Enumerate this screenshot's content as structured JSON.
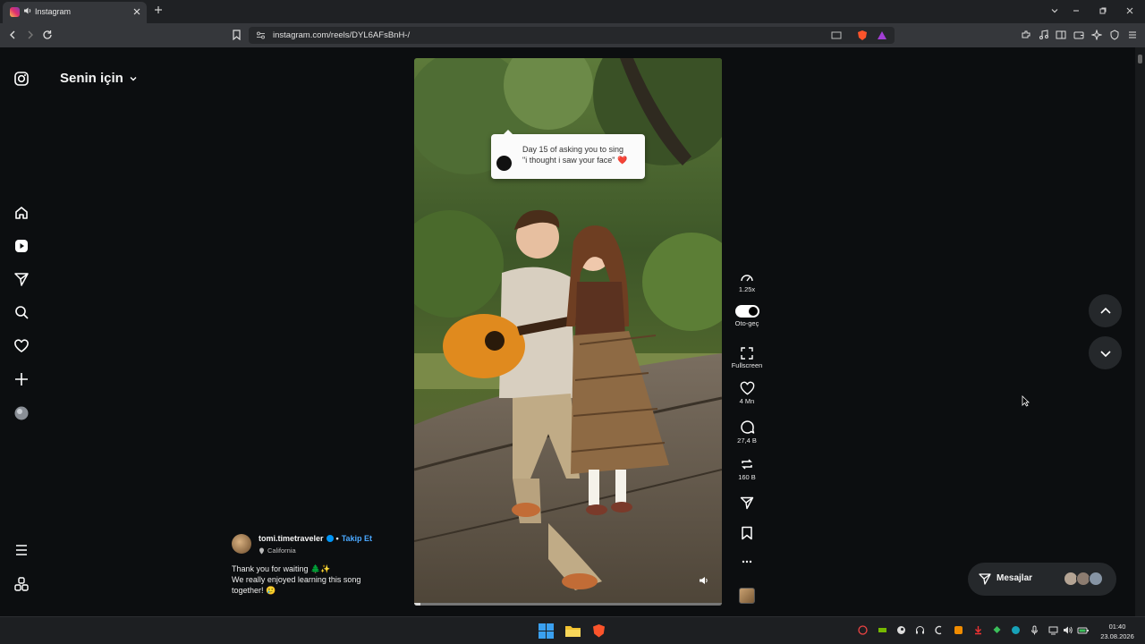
{
  "browser": {
    "tab_title": "Instagram",
    "url": "instagram.com/reels/DYL6AFsBnH-/"
  },
  "feed": {
    "title": "Senin için"
  },
  "reel": {
    "sticker_line1": "Day 15 of asking you to sing",
    "sticker_line2": "\"i thought i saw your face\"",
    "sticker_heart": "❤️",
    "progress": 0.02
  },
  "actions": {
    "speed": "1.25x",
    "autoplay": "Oto-geç",
    "fullscreen": "Fullscreen",
    "likes": "4 Mn",
    "comments": "27,4 B",
    "reposts": "160 B"
  },
  "post": {
    "username": "tomi.timetraveler",
    "separator": "•",
    "follow_label": "Takip Et",
    "location": "California",
    "caption_line1": "Thank you for waiting 🌲✨",
    "caption_line2": "We really enjoyed learning this song",
    "caption_line3": "together! 🥲"
  },
  "messages": {
    "label": "Mesajlar"
  },
  "taskbar": {
    "time": "01:40",
    "date": "23.08.2026"
  },
  "colors": {
    "background": "#0c0e10",
    "accent_blue": "#0095f6",
    "follow_blue": "#4aa8ff"
  }
}
